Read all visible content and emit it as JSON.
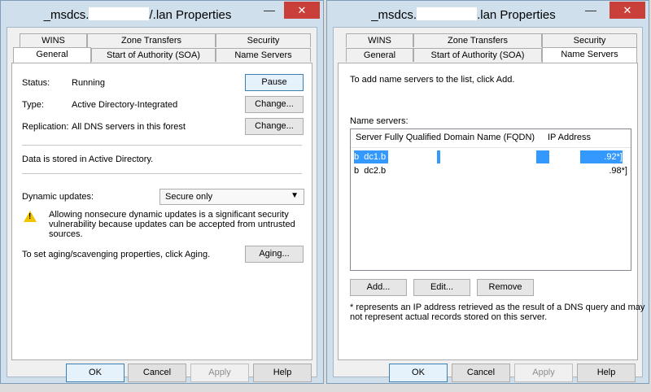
{
  "window_title_prefix": "_msdcs.",
  "window_title_suffix": "/.lan Properties",
  "window_title_suffix_right": ".lan Properties",
  "close_glyph": "✕",
  "minimize_glyph": "—",
  "tabs_row1": [
    "WINS",
    "Zone Transfers",
    "Security"
  ],
  "tabs_row2": [
    "General",
    "Start of Authority (SOA)",
    "Name Servers"
  ],
  "left": {
    "active_tab": "General",
    "status_label": "Status:",
    "status_value": "Running",
    "pause_button": "Pause",
    "type_label": "Type:",
    "type_value": "Active Directory-Integrated",
    "type_change_button": "Change...",
    "replication_label": "Replication:",
    "replication_value": "All DNS servers in this forest",
    "replication_change_button": "Change...",
    "stored_text": "Data is stored in Active Directory.",
    "dynamic_updates_label": "Dynamic updates:",
    "dynamic_updates_value": "Secure only",
    "warning_line1": "Allowing nonsecure dynamic updates is a significant security",
    "warning_line2": "vulnerability because updates can be accepted from untrusted",
    "warning_line3": "sources.",
    "aging_text": "To set aging/scavenging properties, click Aging.",
    "aging_button": "Aging..."
  },
  "right": {
    "active_tab": "Name Servers",
    "intro_text": "To add name servers to the list, click Add.",
    "name_servers_label": "Name servers:",
    "columns": [
      "Server Fully Qualified Domain Name (FQDN)",
      "IP Address"
    ],
    "rows": [
      {
        "fqdn_start": "b",
        "fqdn_mid": "dc1.b",
        "ip_end": ".92*]",
        "selected": true
      },
      {
        "fqdn_start": "b",
        "fqdn_mid": "dc2.b",
        "ip_end": ".98*]",
        "selected": false
      }
    ],
    "add_button": "Add...",
    "edit_button": "Edit...",
    "remove_button": "Remove",
    "footnote_line1": "* represents an IP address retrieved as the result of a DNS query and may",
    "footnote_line2": "not represent actual records stored on this server."
  },
  "footer": {
    "ok": "OK",
    "cancel": "Cancel",
    "apply": "Apply",
    "help": "Help"
  }
}
